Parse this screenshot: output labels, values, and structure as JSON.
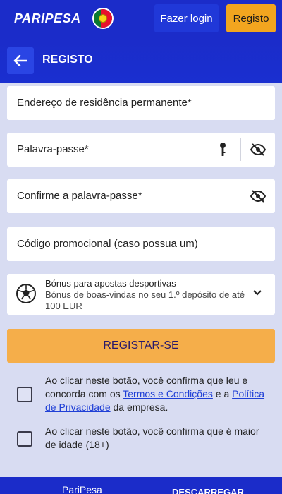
{
  "header": {
    "logo": "PARIPESA",
    "login_label": "Fazer login",
    "register_label": "Registo"
  },
  "subheader": {
    "title": "REGISTO"
  },
  "form": {
    "address_label": "Endereço de residência permanente*",
    "password_label": "Palavra-passe*",
    "confirm_password_label": "Confirme a palavra-passe*",
    "promo_label": "Código promocional (caso possua um)",
    "bonus": {
      "title": "Bónus para apostas desportivas",
      "description": "Bónus de boas-vindas no seu 1.º depósito de até 100 EUR"
    },
    "submit_label": "REGISTAR-SE"
  },
  "consents": {
    "terms": {
      "pre": "Ao clicar neste botão, você confirma que leu e concorda com os ",
      "terms_link": "Termos e Condições",
      "mid": " e a ",
      "privacy_link": "Política de Privacidade",
      "post": " da empresa."
    },
    "age": "Ao clicar neste botão, você confirma que é maior de idade (18+)"
  },
  "bottom": {
    "app_label": "PariPesa",
    "download": "DESCARREGAR"
  },
  "colors": {
    "brand_blue": "#1b2cc9",
    "accent_orange": "#f2a51f",
    "submit_orange": "#f5ae4a",
    "link_blue": "#1f3fd6"
  },
  "icons": [
    "back-arrow-icon",
    "portugal-flag-icon",
    "key-icon",
    "eye-slash-icon",
    "soccer-ball-icon",
    "chevron-down-icon"
  ]
}
